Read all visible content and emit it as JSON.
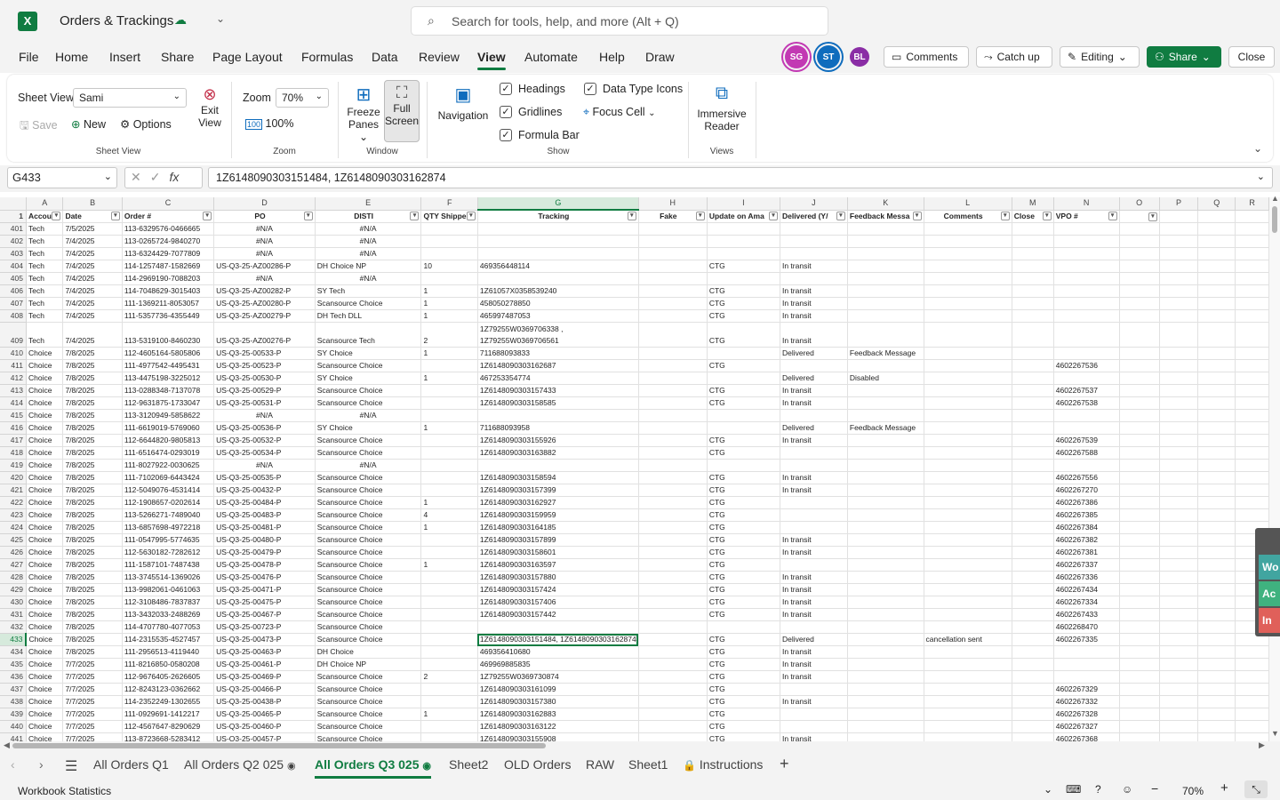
{
  "app": {
    "title": "Orders & Trackings",
    "search_placeholder": "Search for tools, help, and more (Alt + Q)"
  },
  "menu": [
    "File",
    "Home",
    "Insert",
    "Share",
    "Page Layout",
    "Formulas",
    "Data",
    "Review",
    "View",
    "Automate",
    "Help",
    "Draw"
  ],
  "menu_active": "View",
  "collab": {
    "avatars": [
      {
        "initials": "SG",
        "color": "#c239b3"
      },
      {
        "initials": "ST",
        "color": "#0f6cbd"
      },
      {
        "initials": "BL",
        "color": "#8a2da5"
      }
    ],
    "comments": "Comments",
    "catchup": "Catch up",
    "editing": "Editing",
    "share": "Share",
    "close": "Close"
  },
  "ribbon": {
    "sheet_view_label": "Sheet View",
    "sheet_view_value": "Sami",
    "save": "Save",
    "new": "New",
    "options": "Options",
    "exit_view_1": "Exit",
    "exit_view_2": "View",
    "group_sheet_view": "Sheet View",
    "zoom_label": "Zoom",
    "zoom_value": "70%",
    "zoom_100": "100%",
    "group_zoom": "Zoom",
    "freeze_1": "Freeze",
    "freeze_2": "Panes",
    "full_1": "Full",
    "full_2": "Screen",
    "group_window": "Window",
    "navigation": "Navigation",
    "headings": "Headings",
    "gridlines": "Gridlines",
    "formula_bar": "Formula Bar",
    "data_type_icons": "Data Type Icons",
    "focus_cell": "Focus Cell",
    "group_show": "Show",
    "immersive_1": "Immersive",
    "immersive_2": "Reader",
    "group_views": "Views"
  },
  "formula": {
    "name_box": "G433",
    "value": "1Z6148090303151484, 1Z6148090303162874"
  },
  "columns": [
    "A",
    "B",
    "C",
    "D",
    "E",
    "F",
    "G",
    "H",
    "I",
    "J",
    "K",
    "L",
    "M",
    "N",
    "O",
    "P",
    "Q",
    "R"
  ],
  "header_row": [
    "Accou",
    "Date",
    "Order #",
    "PO",
    "DISTI",
    "QTY Shippe",
    "Tracking",
    "Fake",
    "Update on Ama",
    "Delivered (Y/",
    "Feedback Messa",
    "Comments",
    "Close",
    "VPO #",
    "",
    "",
    "",
    ""
  ],
  "rows": [
    [
      "401",
      "Tech",
      "7/5/2025",
      "113-6329576-0466665",
      "#N/A",
      "#N/A",
      "",
      "",
      "",
      "",
      "",
      "",
      "",
      "",
      "",
      "",
      "",
      "",
      ""
    ],
    [
      "402",
      "Tech",
      "7/4/2025",
      "113-0265724-9840270",
      "#N/A",
      "#N/A",
      "",
      "",
      "",
      "",
      "",
      "",
      "",
      "",
      "",
      "",
      "",
      "",
      ""
    ],
    [
      "403",
      "Tech",
      "7/4/2025",
      "113-6324429-7077809",
      "#N/A",
      "#N/A",
      "",
      "",
      "",
      "",
      "",
      "",
      "",
      "",
      "",
      "",
      "",
      "",
      ""
    ],
    [
      "404",
      "Tech",
      "7/4/2025",
      "114-1257487-1582669",
      "US-Q3-25-AZ00286-P",
      "DH Choice NP",
      "10",
      "469356448114",
      "",
      "CTG",
      "In transit",
      "",
      "",
      "",
      "",
      "",
      "",
      "",
      ""
    ],
    [
      "405",
      "Tech",
      "7/4/2025",
      "114-2969190-7088203",
      "#N/A",
      "#N/A",
      "",
      "",
      "",
      "",
      "",
      "",
      "",
      "",
      "",
      "",
      "",
      "",
      ""
    ],
    [
      "406",
      "Tech",
      "7/4/2025",
      "114-7048629-3015403",
      "US-Q3-25-AZ00282-P",
      "SY Tech",
      "1",
      "1Z61057X0358539240",
      "",
      "CTG",
      "In transit",
      "",
      "",
      "",
      "",
      "",
      "",
      "",
      ""
    ],
    [
      "407",
      "Tech",
      "7/4/2025",
      "111-1369211-8053057",
      "US-Q3-25-AZ00280-P",
      "Scansource Choice",
      "1",
      "458050278850",
      "",
      "CTG",
      "In transit",
      "",
      "",
      "",
      "",
      "",
      "",
      "",
      ""
    ],
    [
      "408",
      "Tech",
      "7/4/2025",
      "111-5357736-4355449",
      "US-Q3-25-AZ00279-P",
      "DH Tech DLL",
      "1",
      "465997487053",
      "",
      "CTG",
      "In transit",
      "",
      "",
      "",
      "",
      "",
      "",
      "",
      ""
    ],
    [
      "409",
      "Tech",
      "7/4/2025",
      "113-5319100-8460230",
      "US-Q3-25-AZ00276-P",
      "Scansource Tech",
      "2",
      "1Z79255W0369706561",
      "",
      "CTG",
      "In transit",
      "",
      "",
      "",
      "",
      "",
      "",
      "",
      ""
    ],
    [
      "410",
      "Choice",
      "7/8/2025",
      "112-4605164-5805806",
      "US-Q3-25-00533-P",
      "SY Choice",
      "1",
      "711688093833",
      "",
      "",
      "Delivered",
      "Feedback Message",
      "",
      "",
      "",
      "",
      "",
      "",
      ""
    ],
    [
      "411",
      "Choice",
      "7/8/2025",
      "111-4977542-4495431",
      "US-Q3-25-00523-P",
      "Scansource Choice",
      "",
      "1Z6148090303162687",
      "",
      "CTG",
      "",
      "",
      "",
      "",
      "4602267536",
      "",
      "",
      "",
      ""
    ],
    [
      "412",
      "Choice",
      "7/8/2025",
      "113-4475198-3225012",
      "US-Q3-25-00530-P",
      "SY Choice",
      "1",
      "467253354774",
      "",
      "",
      "Delivered",
      "Disabled",
      "",
      "",
      "",
      "",
      "",
      "",
      ""
    ],
    [
      "413",
      "Choice",
      "7/8/2025",
      "113-0288348-7137078",
      "US-Q3-25-00529-P",
      "Scansource Choice",
      "",
      "1Z6148090303157433",
      "",
      "CTG",
      "In transit",
      "",
      "",
      "",
      "4602267537",
      "",
      "",
      "",
      ""
    ],
    [
      "414",
      "Choice",
      "7/8/2025",
      "112-9631875-1733047",
      "US-Q3-25-00531-P",
      "Scansource Choice",
      "",
      "1Z6148090303158585",
      "",
      "CTG",
      "In transit",
      "",
      "",
      "",
      "4602267538",
      "",
      "",
      "",
      ""
    ],
    [
      "415",
      "Choice",
      "7/8/2025",
      "113-3120949-5858622",
      "#N/A",
      "#N/A",
      "",
      "",
      "",
      "",
      "",
      "",
      "",
      "",
      "",
      "",
      "",
      "",
      ""
    ],
    [
      "416",
      "Choice",
      "7/8/2025",
      "111-6619019-5769060",
      "US-Q3-25-00536-P",
      "SY Choice",
      "1",
      "711688093958",
      "",
      "",
      "Delivered",
      "Feedback Message",
      "",
      "",
      "",
      "",
      "",
      "",
      ""
    ],
    [
      "417",
      "Choice",
      "7/8/2025",
      "112-6644820-9805813",
      "US-Q3-25-00532-P",
      "Scansource Choice",
      "",
      "1Z6148090303155926",
      "",
      "CTG",
      "In transit",
      "",
      "",
      "",
      "4602267539",
      "",
      "",
      "",
      ""
    ],
    [
      "418",
      "Choice",
      "7/8/2025",
      "111-6516474-0293019",
      "US-Q3-25-00534-P",
      "Scansource Choice",
      "",
      "1Z6148090303163882",
      "",
      "CTG",
      "",
      "",
      "",
      "",
      "4602267588",
      "",
      "",
      "",
      ""
    ],
    [
      "419",
      "Choice",
      "7/8/2025",
      "111-8027922-0030625",
      "#N/A",
      "#N/A",
      "",
      "",
      "",
      "",
      "",
      "",
      "",
      "",
      "",
      "",
      "",
      "",
      ""
    ],
    [
      "420",
      "Choice",
      "7/8/2025",
      "111-7102069-6443424",
      "US-Q3-25-00535-P",
      "Scansource Choice",
      "",
      "1Z6148090303158594",
      "",
      "CTG",
      "In transit",
      "",
      "",
      "",
      "4602267556",
      "",
      "",
      "",
      ""
    ],
    [
      "421",
      "Choice",
      "7/8/2025",
      "112-5049076-4531414",
      "US-Q3-25-00432-P",
      "Scansource Choice",
      "",
      "1Z6148090303157399",
      "",
      "CTG",
      "In transit",
      "",
      "",
      "",
      "4602267270",
      "",
      "",
      "",
      ""
    ],
    [
      "422",
      "Choice",
      "7/8/2025",
      "112-1908657-0202614",
      "US-Q3-25-00484-P",
      "Scansource Choice",
      "1",
      "1Z6148090303162927",
      "",
      "CTG",
      "",
      "",
      "",
      "",
      "4602267386",
      "",
      "",
      "",
      ""
    ],
    [
      "423",
      "Choice",
      "7/8/2025",
      "113-5266271-7489040",
      "US-Q3-25-00483-P",
      "Scansource Choice",
      "4",
      "1Z6148090303159959",
      "",
      "CTG",
      "",
      "",
      "",
      "",
      "4602267385",
      "",
      "",
      "",
      ""
    ],
    [
      "424",
      "Choice",
      "7/8/2025",
      "113-6857698-4972218",
      "US-Q3-25-00481-P",
      "Scansource Choice",
      "1",
      "1Z6148090303164185",
      "",
      "CTG",
      "",
      "",
      "",
      "",
      "4602267384",
      "",
      "",
      "",
      ""
    ],
    [
      "425",
      "Choice",
      "7/8/2025",
      "111-0547995-5774635",
      "US-Q3-25-00480-P",
      "Scansource Choice",
      "",
      "1Z6148090303157899",
      "",
      "CTG",
      "In transit",
      "",
      "",
      "",
      "4602267382",
      "",
      "",
      "",
      ""
    ],
    [
      "426",
      "Choice",
      "7/8/2025",
      "112-5630182-7282612",
      "US-Q3-25-00479-P",
      "Scansource Choice",
      "",
      "1Z6148090303158601",
      "",
      "CTG",
      "In transit",
      "",
      "",
      "",
      "4602267381",
      "",
      "",
      "",
      ""
    ],
    [
      "427",
      "Choice",
      "7/8/2025",
      "111-1587101-7487438",
      "US-Q3-25-00478-P",
      "Scansource Choice",
      "1",
      "1Z6148090303163597",
      "",
      "CTG",
      "",
      "",
      "",
      "",
      "4602267337",
      "",
      "",
      "",
      ""
    ],
    [
      "428",
      "Choice",
      "7/8/2025",
      "113-3745514-1369026",
      "US-Q3-25-00476-P",
      "Scansource Choice",
      "",
      "1Z6148090303157880",
      "",
      "CTG",
      "In transit",
      "",
      "",
      "",
      "4602267336",
      "",
      "",
      "",
      ""
    ],
    [
      "429",
      "Choice",
      "7/8/2025",
      "113-9982061-0461063",
      "US-Q3-25-00471-P",
      "Scansource Choice",
      "",
      "1Z6148090303157424",
      "",
      "CTG",
      "In transit",
      "",
      "",
      "",
      "4602267434",
      "",
      "",
      "",
      ""
    ],
    [
      "430",
      "Choice",
      "7/8/2025",
      "112-3108486-7837837",
      "US-Q3-25-00475-P",
      "Scansource Choice",
      "",
      "1Z6148090303157406",
      "",
      "CTG",
      "In transit",
      "",
      "",
      "",
      "4602267334",
      "",
      "",
      "",
      ""
    ],
    [
      "431",
      "Choice",
      "7/8/2025",
      "113-3432033-2488269",
      "US-Q3-25-00467-P",
      "Scansource Choice",
      "",
      "1Z6148090303157442",
      "",
      "CTG",
      "In transit",
      "",
      "",
      "",
      "4602267433",
      "",
      "",
      "",
      ""
    ],
    [
      "432",
      "Choice",
      "7/8/2025",
      "114-4707780-4077053",
      "US-Q3-25-00723-P",
      "Scansource Choice",
      "",
      "",
      "",
      "",
      "",
      "",
      "",
      "",
      "4602268470",
      "",
      "",
      "",
      ""
    ],
    [
      "433",
      "Choice",
      "7/8/2025",
      "114-2315535-4527457",
      "US-Q3-25-00473-P",
      "Scansource Choice",
      "",
      "1Z6148090303151484, 1Z6148090303162874",
      "",
      "CTG",
      "Delivered",
      "",
      "cancellation sent",
      "",
      "4602267335",
      "",
      "",
      "",
      ""
    ],
    [
      "434",
      "Choice",
      "7/8/2025",
      "111-2956513-4119440",
      "US-Q3-25-00463-P",
      "DH Choice",
      "",
      "469356410680",
      "",
      "CTG",
      "In transit",
      "",
      "",
      "",
      "",
      "",
      "",
      "",
      ""
    ],
    [
      "435",
      "Choice",
      "7/7/2025",
      "111-8216850-0580208",
      "US-Q3-25-00461-P",
      "DH Choice NP",
      "",
      "469969885835",
      "",
      "CTG",
      "In transit",
      "",
      "",
      "",
      "",
      "",
      "",
      "",
      ""
    ],
    [
      "436",
      "Choice",
      "7/7/2025",
      "112-9676405-2626605",
      "US-Q3-25-00469-P",
      "Scansource Choice",
      "2",
      "1Z79255W0369730874",
      "",
      "CTG",
      "In transit",
      "",
      "",
      "",
      "",
      "",
      "",
      "",
      ""
    ],
    [
      "437",
      "Choice",
      "7/7/2025",
      "112-8243123-0362662",
      "US-Q3-25-00466-P",
      "Scansource Choice",
      "",
      "1Z6148090303161099",
      "",
      "CTG",
      "",
      "",
      "",
      "",
      "4602267329",
      "",
      "",
      "",
      ""
    ],
    [
      "438",
      "Choice",
      "7/7/2025",
      "114-2352249-1302655",
      "US-Q3-25-00438-P",
      "Scansource Choice",
      "",
      "1Z6148090303157380",
      "",
      "CTG",
      "In transit",
      "",
      "",
      "",
      "4602267332",
      "",
      "",
      "",
      ""
    ],
    [
      "439",
      "Choice",
      "7/7/2025",
      "111-0929691-1412217",
      "US-Q3-25-00465-P",
      "Scansource Choice",
      "1",
      "1Z6148090303162883",
      "",
      "CTG",
      "",
      "",
      "",
      "",
      "4602267328",
      "",
      "",
      "",
      ""
    ],
    [
      "440",
      "Choice",
      "7/7/2025",
      "112-4567647-8290629",
      "US-Q3-25-00460-P",
      "Scansource Choice",
      "",
      "1Z6148090303163122",
      "",
      "CTG",
      "",
      "",
      "",
      "",
      "4602267327",
      "",
      "",
      "",
      ""
    ],
    [
      "441",
      "Choice",
      "7/7/2025",
      "113-8723668-5283412",
      "US-Q3-25-00457-P",
      "Scansource Choice",
      "",
      "1Z6148090303155908",
      "",
      "CTG",
      "In transit",
      "",
      "",
      "",
      "4602267368",
      "",
      "",
      "",
      ""
    ]
  ],
  "row409_extra": "1Z79255W0369706338 ,",
  "sheets": [
    "All Orders Q1",
    "All Orders Q2 025",
    "All Orders Q3 025",
    "Sheet2",
    "OLD Orders",
    "RAW",
    "Sheet1",
    "Instructions"
  ],
  "active_sheet": "All Orders Q3 025",
  "status": {
    "left": "Workbook Statistics",
    "zoom": "70%"
  },
  "side_chips": [
    {
      "label": "Wo",
      "color": "#41a5a0"
    },
    {
      "label": "Ac",
      "color": "#3fb27f"
    },
    {
      "label": "In",
      "color": "#e0605a"
    }
  ]
}
